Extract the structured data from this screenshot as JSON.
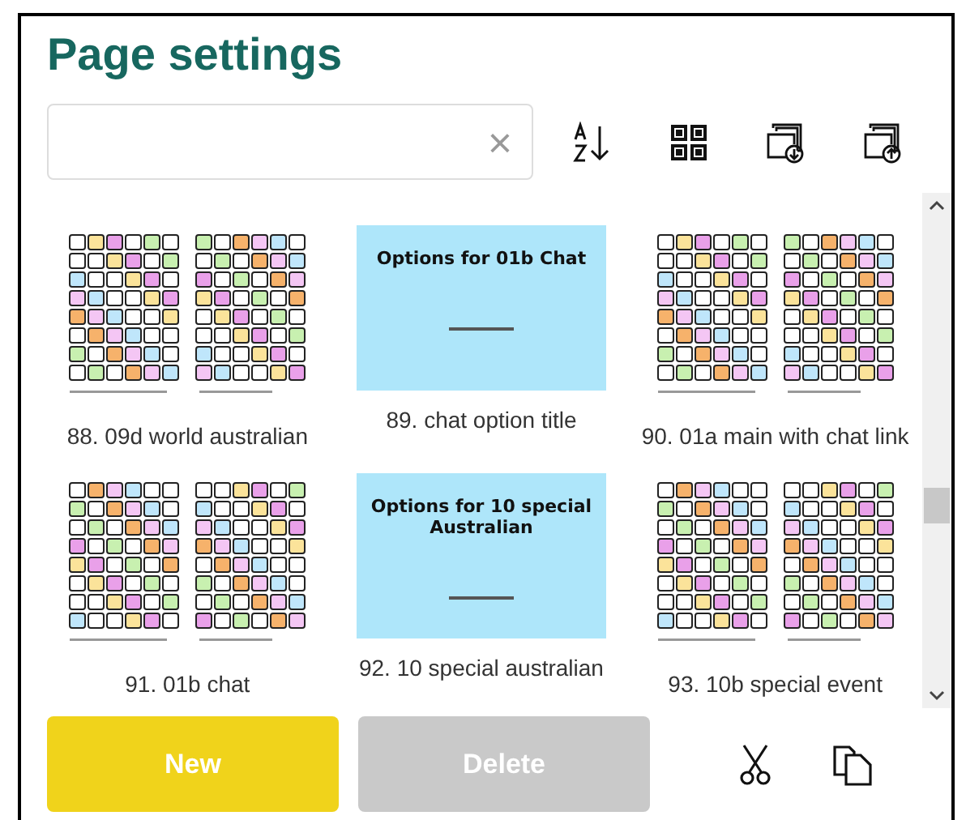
{
  "title": "Page settings",
  "search": {
    "clear_icon": "×"
  },
  "pages": [
    {
      "label": "88. 09d world australian",
      "kind": "grid",
      "selected": false
    },
    {
      "label": "89. chat option title",
      "kind": "title",
      "slide_title": "Options for 01b Chat",
      "selected": false
    },
    {
      "label": "90. 01a main with chat link",
      "kind": "grid",
      "selected": false
    },
    {
      "label": "91. 01b chat",
      "kind": "grid",
      "selected": false
    },
    {
      "label": "92. 10 special australian",
      "kind": "title",
      "slide_title": "Options for 10 special Australian",
      "selected": false
    },
    {
      "label": "93. 10b special event",
      "kind": "grid",
      "selected": false
    }
  ],
  "buttons": [
    {
      "label": "New",
      "disabled": false
    },
    {
      "label": "Delete",
      "disabled": true
    }
  ]
}
